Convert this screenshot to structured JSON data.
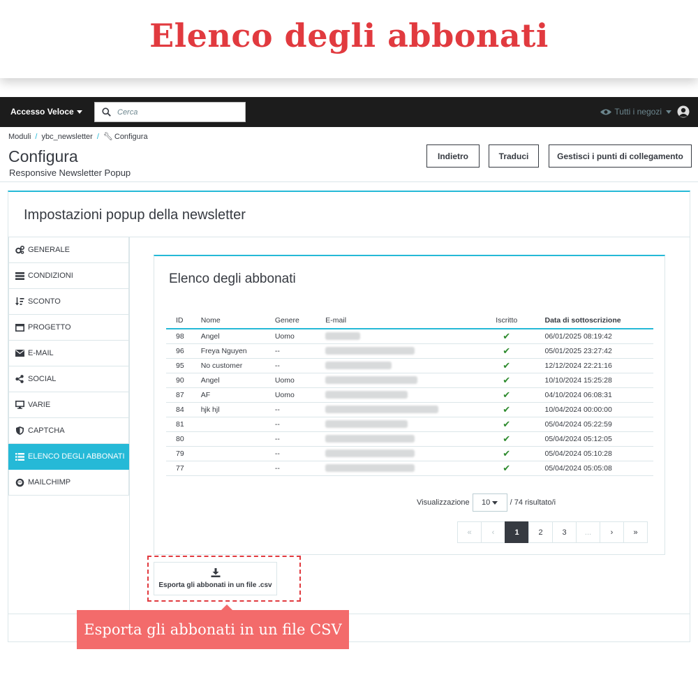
{
  "banner": {
    "title": "Elenco degli abbonati"
  },
  "topbar": {
    "quick_access": "Accesso Veloce",
    "search_placeholder": "Cerca",
    "shop_select": "Tutti i negozi"
  },
  "breadcrumb": [
    "Moduli",
    "ybc_newsletter",
    "Configura"
  ],
  "header": {
    "title": "Configura",
    "subtitle": "Responsive Newsletter Popup",
    "buttons": {
      "back": "Indietro",
      "translate": "Traduci",
      "hooks": "Gestisci i punti di collegamento"
    }
  },
  "panel": {
    "heading": "Impostazioni popup della newsletter",
    "sidebar": [
      {
        "label": "GENERALE",
        "icon": "gears-icon"
      },
      {
        "label": "CONDIZIONI",
        "icon": "list-icon"
      },
      {
        "label": "SCONTO",
        "icon": "sort-icon"
      },
      {
        "label": "PROGETTO",
        "icon": "window-icon"
      },
      {
        "label": "E-MAIL",
        "icon": "envelope-icon"
      },
      {
        "label": "SOCIAL",
        "icon": "share-icon"
      },
      {
        "label": "VARIE",
        "icon": "desktop-icon"
      },
      {
        "label": "CAPTCHA",
        "icon": "shield-icon"
      },
      {
        "label": "ELENCO DEGLI ABBONATI",
        "icon": "list-icon",
        "active": true
      },
      {
        "label": "MAILCHIMP",
        "icon": "mailchimp-icon"
      }
    ]
  },
  "subscribers": {
    "title": "Elenco degli abbonati",
    "columns": [
      "ID",
      "Nome",
      "Genere",
      "E-mail",
      "Iscritto",
      "Data di sottoscrizione"
    ],
    "rows": [
      {
        "id": "98",
        "name": "Angel",
        "gender": "Uomo",
        "date": "06/01/2025 08:19:42"
      },
      {
        "id": "96",
        "name": "Freya Nguyen",
        "gender": "--",
        "date": "05/01/2025 23:27:42"
      },
      {
        "id": "95",
        "name": "No customer",
        "gender": "--",
        "date": "12/12/2024 22:21:16"
      },
      {
        "id": "90",
        "name": "Angel",
        "gender": "Uomo",
        "date": "10/10/2024 15:25:28"
      },
      {
        "id": "87",
        "name": "AF",
        "gender": "Uomo",
        "date": "04/10/2024 06:08:31"
      },
      {
        "id": "84",
        "name": "hjk hjl",
        "gender": "--",
        "date": "10/04/2024 00:00:00"
      },
      {
        "id": "81",
        "name": "",
        "gender": "--",
        "date": "05/04/2024 05:22:59"
      },
      {
        "id": "80",
        "name": "",
        "gender": "--",
        "date": "05/04/2024 05:12:05"
      },
      {
        "id": "79",
        "name": "",
        "gender": "--",
        "date": "05/04/2024 05:10:28"
      },
      {
        "id": "77",
        "name": "",
        "gender": "--",
        "date": "05/04/2024 05:05:08"
      }
    ],
    "pagination": {
      "display_label": "Visualizzazione",
      "per_page": "10",
      "total": "/ 74 risultato/i",
      "pages": [
        "«",
        "‹",
        "1",
        "2",
        "3",
        "...",
        "›",
        "»"
      ],
      "current": "1"
    },
    "export_button": "Esporta gli abbonati in un file .csv"
  },
  "callout": {
    "text": "Esporta gli abbonati in un file CSV"
  },
  "colors": {
    "accent": "#25b9d7",
    "banner_red": "#e13a3f",
    "callout_bg": "#f36b6b",
    "topbar": "#1c1c1c"
  }
}
